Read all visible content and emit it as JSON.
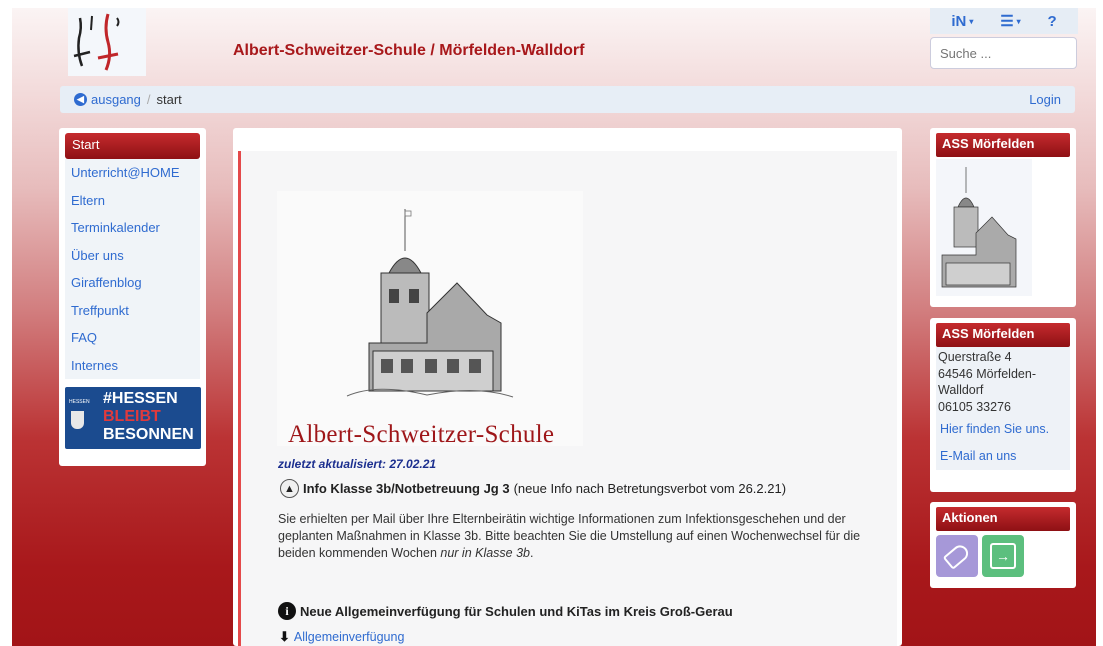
{
  "header": {
    "site_title": "Albert-Schweitzer-Schule / Mörfelden-Walldorf",
    "search_placeholder": "Suche ...",
    "icons": [
      "users-icon",
      "menu-icon",
      "help-icon"
    ]
  },
  "breadcrumb": {
    "back_label": "ausgang",
    "separator": "/",
    "current": "start",
    "login_label": "Login"
  },
  "sidebar": {
    "active": "Start",
    "items": [
      {
        "label": "Unterricht@HOME"
      },
      {
        "label": "Eltern"
      },
      {
        "label": "Terminkalender"
      },
      {
        "label": "Über uns"
      },
      {
        "label": "Giraffenblog"
      },
      {
        "label": "Treffpunkt"
      },
      {
        "label": "FAQ"
      },
      {
        "label": "Internes"
      }
    ],
    "banner": {
      "small": "HESSEN",
      "line1": "#HESSEN",
      "line2": "BLEIBT",
      "line3": "BESONNEN"
    }
  },
  "main": {
    "school_name": "Albert-Schweitzer-Schule",
    "updated": "zuletzt aktualisiert: 27.02.21",
    "info_title": "Info Klasse 3b/Notbetreuung Jg 3",
    "info_note": "(neue Info nach Betretungsverbot vom 26.2.21)",
    "paragraph_main": "Sie erhielten per Mail über Ihre Elternbeirätin wichtige Informationen zum Infektionsgeschehen und der geplanten Maßnahmen in Klasse 3b. Bitte beachten Sie die Umstellung auf einen Wochenwechsel für die beiden kommenden Wochen ",
    "paragraph_italic": "nur in Klasse 3b",
    "paragraph_end": ".",
    "news_title": "Neue Allgemeinverfügung für Schulen und KiTas im Kreis Groß-Gerau",
    "download_label": "Allgemeinverfügung"
  },
  "right": {
    "box1_title": "ASS Mörfelden",
    "box2_title": "ASS Mörfelden",
    "address": [
      "Querstraße 4",
      "64546 Mörfelden-",
      "Walldorf",
      "06105 33276"
    ],
    "find_link": "Hier finden Sie uns.",
    "mail_link": "E-Mail an uns",
    "box3_title": "Aktionen"
  },
  "colors": {
    "accent_red": "#a8181b",
    "link_blue": "#2f6bd0"
  }
}
